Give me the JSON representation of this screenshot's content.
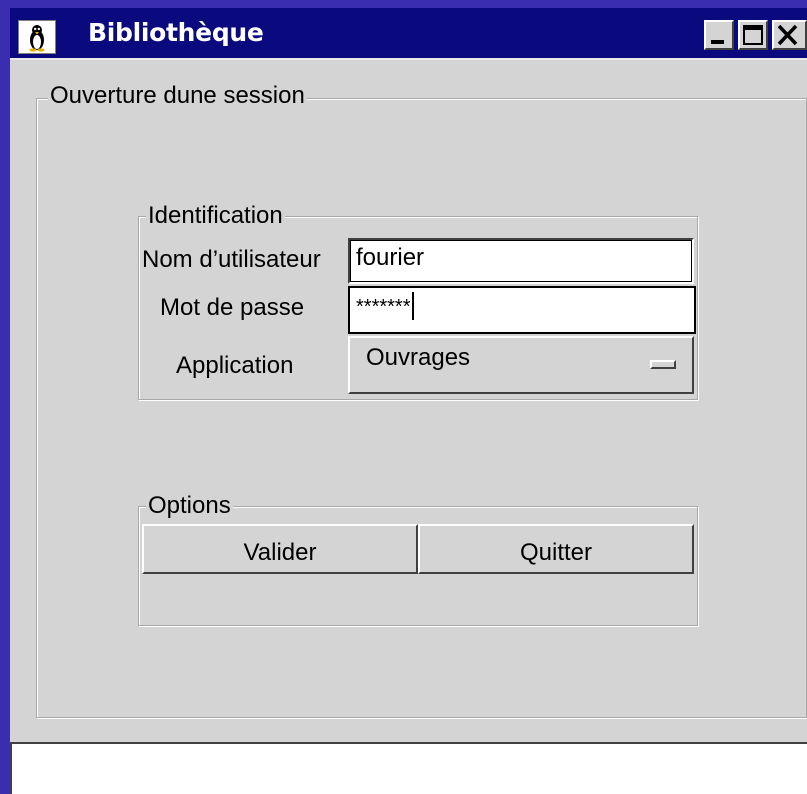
{
  "window": {
    "title": "Bibliothèque",
    "icons": {
      "app": "penguin-icon",
      "minimize": "minimize-icon",
      "maximize": "maximize-icon",
      "close": "close-icon"
    },
    "colors": {
      "titlebar": "#0a0a7e",
      "desktop": "#3a2db0",
      "face": "#d4d4d4"
    }
  },
  "session": {
    "group_title": "Ouverture dune session"
  },
  "identification": {
    "group_title": "Identification",
    "username_label": "Nom d’utilisateur",
    "username_value": "fourier",
    "password_label": "Mot de passe",
    "password_value": "*******",
    "application_label": "Application",
    "application_value": "Ouvrages"
  },
  "options": {
    "group_title": "Options",
    "validate_label": "Valider",
    "quit_label": "Quitter"
  },
  "statusbar": {
    "text": ""
  }
}
